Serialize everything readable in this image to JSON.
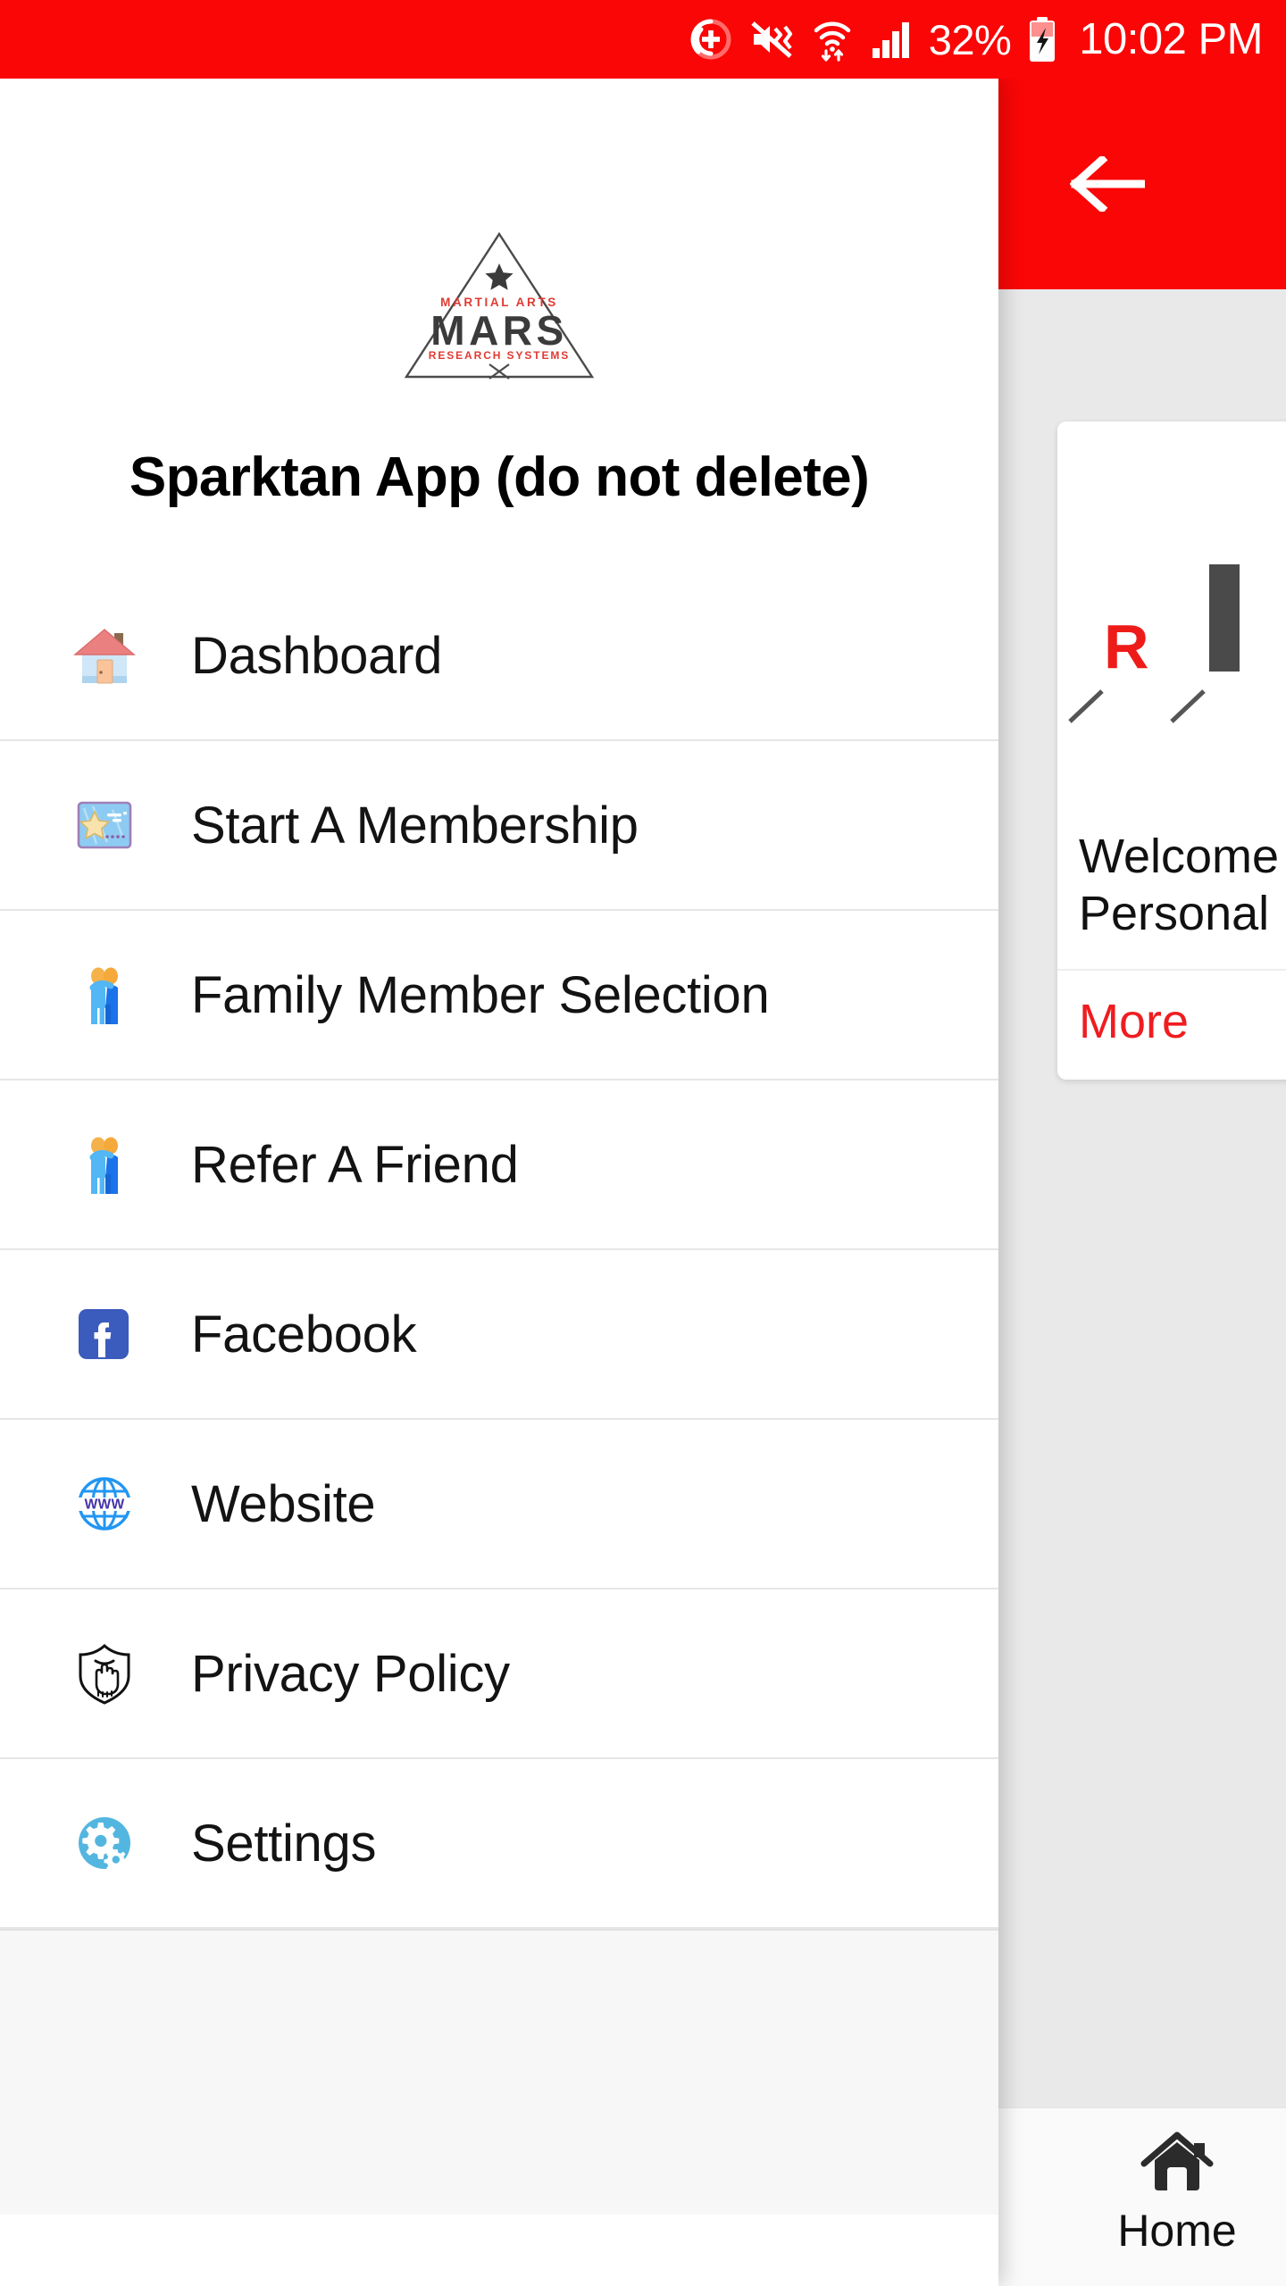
{
  "status_bar": {
    "background": "#fa0606",
    "icons": [
      {
        "name": "do-not-disturb-icon",
        "glyph": "plus-circle"
      },
      {
        "name": "mute-vibrate-icon",
        "glyph": "speaker-muted"
      },
      {
        "name": "wifi-icon",
        "glyph": "wifi-arrows"
      },
      {
        "name": "cellular-signal-icon",
        "glyph": "signal-bars"
      }
    ],
    "battery_percent": "32%",
    "battery_icon": "battery-charging-icon",
    "time": "10:02 PM"
  },
  "app_bar": {
    "back_label": "back-arrow",
    "background": "#fa0606"
  },
  "drawer": {
    "logo": {
      "name": "mars-logo",
      "top_text": "MARTIAL ARTS",
      "main_text": "MARS",
      "bottom_text": "RESEARCH SYSTEMS",
      "accent_color": "#e03a33",
      "text_color": "#3b3b3b"
    },
    "title": "Sparktan App (do not delete)",
    "items": [
      {
        "label": "Dashboard",
        "icon": "house-icon"
      },
      {
        "label": "Start A Membership",
        "icon": "ticket-star-icon"
      },
      {
        "label": "Family Member Selection",
        "icon": "two-people-icon"
      },
      {
        "label": "Refer A Friend",
        "icon": "two-people-icon"
      },
      {
        "label": "Facebook",
        "icon": "facebook-icon"
      },
      {
        "label": "Website",
        "icon": "globe-www-icon"
      },
      {
        "label": "Privacy Policy",
        "icon": "shield-hand-icon"
      },
      {
        "label": "Settings",
        "icon": "gears-icon"
      }
    ]
  },
  "feed_card": {
    "title_line1": "Welcome",
    "title_line2": "Personal",
    "action_label": "More",
    "action_color": "#ef1d20",
    "media_letter": "R"
  },
  "bottom_nav": {
    "items": [
      {
        "label": "Home",
        "icon": "home-icon"
      }
    ]
  }
}
